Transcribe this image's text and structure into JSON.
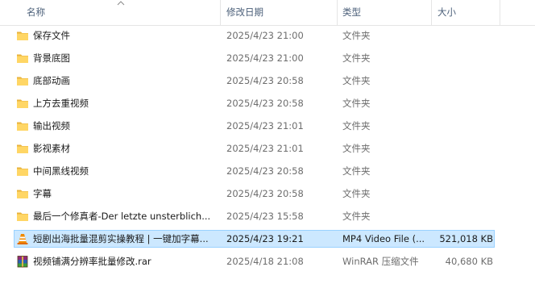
{
  "header": {
    "name": "名称",
    "date": "修改日期",
    "type": "类型",
    "size": "大小"
  },
  "colors": {
    "folder": "#ffd665",
    "folder_dark": "#e8b33c",
    "selection_bg": "#cce8ff",
    "selection_border": "#99d1ff",
    "header_text": "#4c607a",
    "secondary_text": "#6d6d6d"
  },
  "files": [
    {
      "name": "保存文件",
      "date": "2025/4/23 21:00",
      "type": "文件夹",
      "size": "",
      "icon": "folder-icon",
      "selected": false
    },
    {
      "name": "背景底图",
      "date": "2025/4/23 21:00",
      "type": "文件夹",
      "size": "",
      "icon": "folder-icon",
      "selected": false
    },
    {
      "name": "底部动画",
      "date": "2025/4/23 20:58",
      "type": "文件夹",
      "size": "",
      "icon": "folder-icon",
      "selected": false
    },
    {
      "name": "上方去重视频",
      "date": "2025/4/23 20:58",
      "type": "文件夹",
      "size": "",
      "icon": "folder-icon",
      "selected": false
    },
    {
      "name": "输出视频",
      "date": "2025/4/23 21:01",
      "type": "文件夹",
      "size": "",
      "icon": "folder-icon",
      "selected": false
    },
    {
      "name": "影视素材",
      "date": "2025/4/23 21:01",
      "type": "文件夹",
      "size": "",
      "icon": "folder-icon",
      "selected": false
    },
    {
      "name": "中间黑线视频",
      "date": "2025/4/23 20:58",
      "type": "文件夹",
      "size": "",
      "icon": "folder-icon",
      "selected": false
    },
    {
      "name": "字幕",
      "date": "2025/4/23 20:58",
      "type": "文件夹",
      "size": "",
      "icon": "folder-icon",
      "selected": false
    },
    {
      "name": "最后一个修真者-Der letzte unsterblich...",
      "date": "2025/4/23 15:58",
      "type": "文件夹",
      "size": "",
      "icon": "folder-icon",
      "selected": false
    },
    {
      "name": "短剧出海批量混剪实操教程 | 一键加字幕...",
      "date": "2025/4/23 19:21",
      "type": "MP4 Video File (...",
      "size": "521,018 KB",
      "icon": "vlc-cone-icon",
      "selected": true
    },
    {
      "name": "视频铺满分辨率批量修改.rar",
      "date": "2025/4/18 21:08",
      "type": "WinRAR 压缩文件",
      "size": "40,680 KB",
      "icon": "winrar-archive-icon",
      "selected": false
    }
  ]
}
